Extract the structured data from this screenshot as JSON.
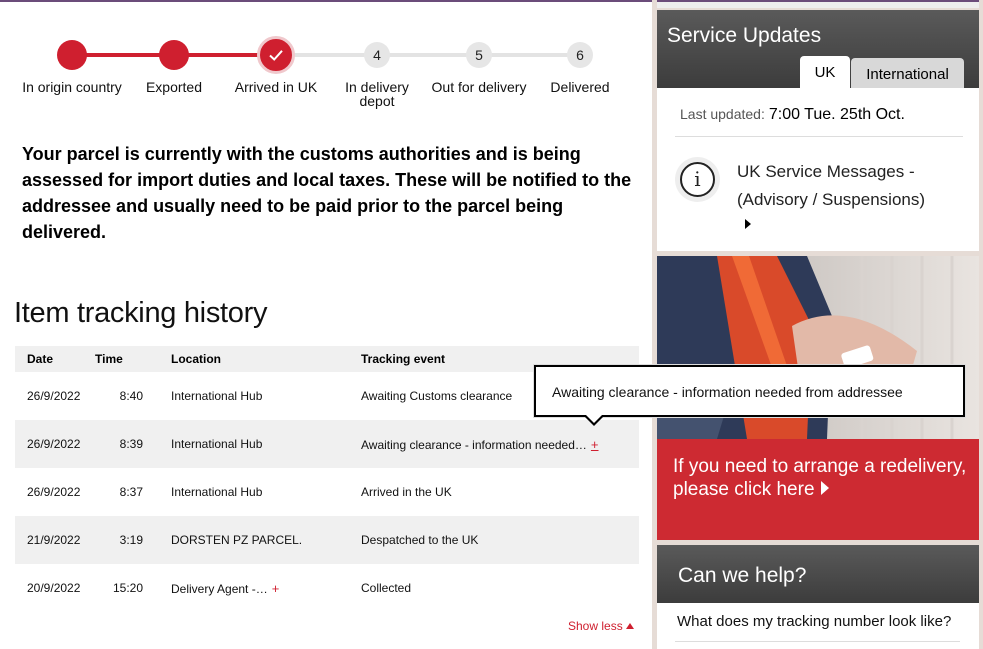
{
  "tracker": {
    "steps": [
      {
        "label": "In origin country",
        "state": "done"
      },
      {
        "label": "Exported",
        "state": "done"
      },
      {
        "label": "Arrived in UK",
        "state": "current"
      },
      {
        "label": "In delivery depot",
        "state": "pending",
        "number": "4"
      },
      {
        "label": "Out for delivery",
        "state": "pending",
        "number": "5"
      },
      {
        "label": "Delivered",
        "state": "pending",
        "number": "6"
      }
    ]
  },
  "status_message": "Your parcel is currently with the customs authorities and is being assessed for import duties and local taxes. These will be notified to the addressee and usually need to be paid prior to the parcel being delivered.",
  "history": {
    "title": "Item tracking history",
    "columns": [
      "Date",
      "Time",
      "Location",
      "Tracking event"
    ],
    "rows": [
      {
        "date": "26/9/2022",
        "time": "8:40",
        "location": "International Hub",
        "event": "Awaiting Customs clearance"
      },
      {
        "date": "26/9/2022",
        "time": "8:39",
        "location": "International Hub",
        "event": "Awaiting clearance - information needed…",
        "event_more": "+"
      },
      {
        "date": "26/9/2022",
        "time": "8:37",
        "location": "International Hub",
        "event": "Arrived in the UK"
      },
      {
        "date": "21/9/2022",
        "time": "3:19",
        "location": "DORSTEN PZ PARCEL.",
        "event": "Despatched to the UK"
      },
      {
        "date": "20/9/2022",
        "time": "15:20",
        "location": "Delivery Agent -…",
        "location_more": "+",
        "event": "Collected"
      }
    ],
    "show_less": "Show less"
  },
  "tooltip": {
    "text": "Awaiting clearance - information needed from addressee"
  },
  "service_updates": {
    "title": "Service Updates",
    "tabs": [
      {
        "label": "UK",
        "active": true
      },
      {
        "label": "International",
        "active": false
      }
    ],
    "last_updated_label": "Last updated:",
    "last_updated_value": "7:00 Tue. 25th Oct.",
    "message": "UK Service Messages - (Advisory / Suspensions)",
    "icon": "info-icon"
  },
  "promo": {
    "text": "If you need to arrange a redelivery, please click here"
  },
  "help": {
    "title": "Can we help?",
    "items": [
      "What does my tracking number look like?"
    ]
  },
  "colors": {
    "accent_red": "#cf1f2f",
    "panel_dark": "#4a4a4a",
    "promo_red": "#cd2a32"
  }
}
